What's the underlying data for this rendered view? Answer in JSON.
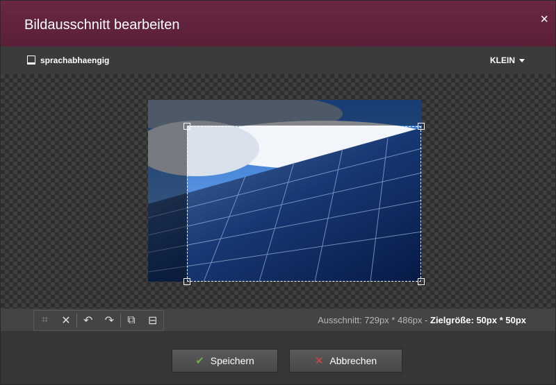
{
  "dialog": {
    "title": "Bildausschnitt bearbeiten",
    "close_glyph": "×"
  },
  "subbar": {
    "checkbox_label": "sprachabhaengig",
    "size_value": "KLEIN"
  },
  "toolbar": {
    "tools": [
      {
        "name": "crop-icon",
        "glyph": "⌗"
      },
      {
        "name": "reset-icon",
        "glyph": "✕"
      },
      {
        "name": "undo-icon",
        "glyph": "↶"
      },
      {
        "name": "redo-icon",
        "glyph": "↷"
      },
      {
        "name": "flip-horizontal-icon",
        "glyph": "⧉"
      },
      {
        "name": "flip-vertical-icon",
        "glyph": "⊟"
      }
    ],
    "info_prefix": "Ausschnitt: 729px * 486px - ",
    "info_target_label": "Zielgröße: 50px * 50px"
  },
  "footer": {
    "save_label": "Speichern",
    "cancel_label": "Abbrechen"
  },
  "colors": {
    "titlebar": "#5a1f38",
    "save_icon": "#6ab04c",
    "cancel_icon": "#dd4444"
  }
}
